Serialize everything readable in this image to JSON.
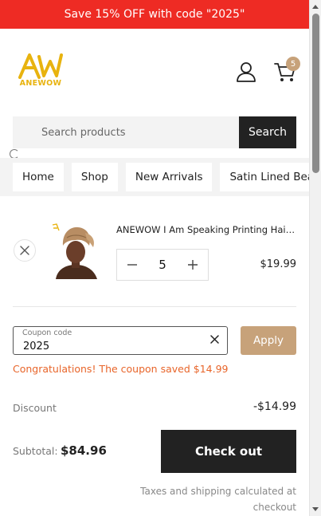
{
  "announcement": {
    "text": "Save 15% OFF with code \"2025\""
  },
  "header": {
    "logo_text": "ANEWOW",
    "cart_count": "5",
    "icons": {
      "account": "user-icon",
      "cart": "cart-icon"
    }
  },
  "search": {
    "placeholder": "Search products",
    "button_label": "Search"
  },
  "nav": {
    "items": [
      {
        "label": "Home"
      },
      {
        "label": "Shop"
      },
      {
        "label": "New Arrivals"
      },
      {
        "label": "Satin Lined Beanies"
      }
    ]
  },
  "cart_item": {
    "title": "ANEWOW I Am Speaking Printing Hair B...",
    "quantity": "5",
    "price": "$19.99",
    "remove_icon": "close-icon",
    "minus_icon": "minus-icon",
    "plus_icon": "plus-icon"
  },
  "coupon": {
    "label": "Coupon code",
    "value": "2025",
    "apply_label": "Apply",
    "message": "Congratulations!  The coupon saved $14.99"
  },
  "summary": {
    "discount_label": "Discount",
    "discount_value": "-$14.99",
    "subtotal_label": "Subtotal:",
    "subtotal_value": "$84.96",
    "checkout_label": "Check out",
    "tax_note": "Taxes and shipping calculated at checkout"
  },
  "colors": {
    "announcement_bg": "#ee2b24",
    "accent": "#c7a27a",
    "logo": "#e8b30f",
    "success_text": "#e8652a",
    "dark_button": "#222222"
  }
}
